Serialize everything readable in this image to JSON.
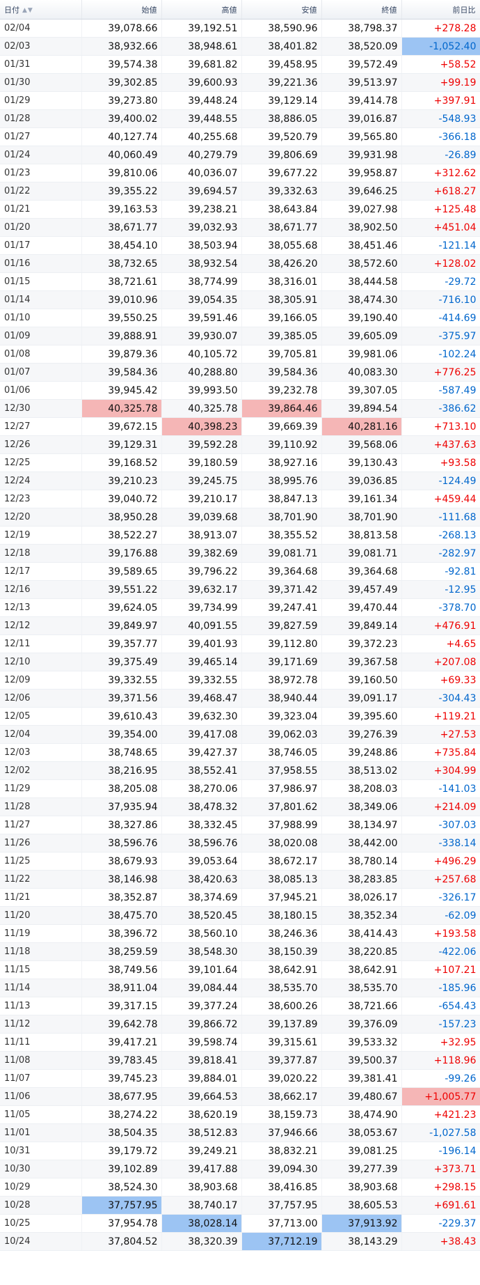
{
  "headers": {
    "date": "日付",
    "sort_icon": "▲▼",
    "open": "始値",
    "high": "高値",
    "low": "安値",
    "close": "終値",
    "change": "前日比"
  },
  "colors": {
    "positive": "#ee0000",
    "negative": "#0066cc",
    "highlight_red": "#f5b6b6",
    "highlight_blue": "#9cc4f3"
  },
  "rows": [
    {
      "date": "02/04",
      "open": "39,078.66",
      "high": "39,192.51",
      "low": "38,590.96",
      "close": "38,798.37",
      "change": "+278.28",
      "dir": "pos"
    },
    {
      "date": "02/03",
      "open": "38,932.66",
      "high": "38,948.61",
      "low": "38,401.82",
      "close": "38,520.09",
      "change": "-1,052.40",
      "dir": "neg",
      "hl": {
        "change": "blue"
      }
    },
    {
      "date": "01/31",
      "open": "39,574.38",
      "high": "39,681.82",
      "low": "39,458.95",
      "close": "39,572.49",
      "change": "+58.52",
      "dir": "pos"
    },
    {
      "date": "01/30",
      "open": "39,302.85",
      "high": "39,600.93",
      "low": "39,221.36",
      "close": "39,513.97",
      "change": "+99.19",
      "dir": "pos"
    },
    {
      "date": "01/29",
      "open": "39,273.80",
      "high": "39,448.24",
      "low": "39,129.14",
      "close": "39,414.78",
      "change": "+397.91",
      "dir": "pos"
    },
    {
      "date": "01/28",
      "open": "39,400.02",
      "high": "39,448.55",
      "low": "38,886.05",
      "close": "39,016.87",
      "change": "-548.93",
      "dir": "neg"
    },
    {
      "date": "01/27",
      "open": "40,127.74",
      "high": "40,255.68",
      "low": "39,520.79",
      "close": "39,565.80",
      "change": "-366.18",
      "dir": "neg"
    },
    {
      "date": "01/24",
      "open": "40,060.49",
      "high": "40,279.79",
      "low": "39,806.69",
      "close": "39,931.98",
      "change": "-26.89",
      "dir": "neg"
    },
    {
      "date": "01/23",
      "open": "39,810.06",
      "high": "40,036.07",
      "low": "39,677.22",
      "close": "39,958.87",
      "change": "+312.62",
      "dir": "pos"
    },
    {
      "date": "01/22",
      "open": "39,355.22",
      "high": "39,694.57",
      "low": "39,332.63",
      "close": "39,646.25",
      "change": "+618.27",
      "dir": "pos"
    },
    {
      "date": "01/21",
      "open": "39,163.53",
      "high": "39,238.21",
      "low": "38,643.84",
      "close": "39,027.98",
      "change": "+125.48",
      "dir": "pos"
    },
    {
      "date": "01/20",
      "open": "38,671.77",
      "high": "39,032.93",
      "low": "38,671.77",
      "close": "38,902.50",
      "change": "+451.04",
      "dir": "pos"
    },
    {
      "date": "01/17",
      "open": "38,454.10",
      "high": "38,503.94",
      "low": "38,055.68",
      "close": "38,451.46",
      "change": "-121.14",
      "dir": "neg"
    },
    {
      "date": "01/16",
      "open": "38,732.65",
      "high": "38,932.54",
      "low": "38,426.20",
      "close": "38,572.60",
      "change": "+128.02",
      "dir": "pos"
    },
    {
      "date": "01/15",
      "open": "38,721.61",
      "high": "38,774.99",
      "low": "38,316.01",
      "close": "38,444.58",
      "change": "-29.72",
      "dir": "neg"
    },
    {
      "date": "01/14",
      "open": "39,010.96",
      "high": "39,054.35",
      "low": "38,305.91",
      "close": "38,474.30",
      "change": "-716.10",
      "dir": "neg"
    },
    {
      "date": "01/10",
      "open": "39,550.25",
      "high": "39,591.46",
      "low": "39,166.05",
      "close": "39,190.40",
      "change": "-414.69",
      "dir": "neg"
    },
    {
      "date": "01/09",
      "open": "39,888.91",
      "high": "39,930.07",
      "low": "39,385.05",
      "close": "39,605.09",
      "change": "-375.97",
      "dir": "neg"
    },
    {
      "date": "01/08",
      "open": "39,879.36",
      "high": "40,105.72",
      "low": "39,705.81",
      "close": "39,981.06",
      "change": "-102.24",
      "dir": "neg"
    },
    {
      "date": "01/07",
      "open": "39,584.36",
      "high": "40,288.80",
      "low": "39,584.36",
      "close": "40,083.30",
      "change": "+776.25",
      "dir": "pos"
    },
    {
      "date": "01/06",
      "open": "39,945.42",
      "high": "39,993.50",
      "low": "39,232.78",
      "close": "39,307.05",
      "change": "-587.49",
      "dir": "neg"
    },
    {
      "date": "12/30",
      "open": "40,325.78",
      "high": "40,325.78",
      "low": "39,864.46",
      "close": "39,894.54",
      "change": "-386.62",
      "dir": "neg",
      "hl": {
        "open": "red",
        "low": "red"
      }
    },
    {
      "date": "12/27",
      "open": "39,672.15",
      "high": "40,398.23",
      "low": "39,669.39",
      "close": "40,281.16",
      "change": "+713.10",
      "dir": "pos",
      "hl": {
        "high": "red",
        "close": "red"
      }
    },
    {
      "date": "12/26",
      "open": "39,129.31",
      "high": "39,592.28",
      "low": "39,110.92",
      "close": "39,568.06",
      "change": "+437.63",
      "dir": "pos"
    },
    {
      "date": "12/25",
      "open": "39,168.52",
      "high": "39,180.59",
      "low": "38,927.16",
      "close": "39,130.43",
      "change": "+93.58",
      "dir": "pos"
    },
    {
      "date": "12/24",
      "open": "39,210.23",
      "high": "39,245.75",
      "low": "38,995.76",
      "close": "39,036.85",
      "change": "-124.49",
      "dir": "neg"
    },
    {
      "date": "12/23",
      "open": "39,040.72",
      "high": "39,210.17",
      "low": "38,847.13",
      "close": "39,161.34",
      "change": "+459.44",
      "dir": "pos"
    },
    {
      "date": "12/20",
      "open": "38,950.28",
      "high": "39,039.68",
      "low": "38,701.90",
      "close": "38,701.90",
      "change": "-111.68",
      "dir": "neg"
    },
    {
      "date": "12/19",
      "open": "38,522.27",
      "high": "38,913.07",
      "low": "38,355.52",
      "close": "38,813.58",
      "change": "-268.13",
      "dir": "neg"
    },
    {
      "date": "12/18",
      "open": "39,176.88",
      "high": "39,382.69",
      "low": "39,081.71",
      "close": "39,081.71",
      "change": "-282.97",
      "dir": "neg"
    },
    {
      "date": "12/17",
      "open": "39,589.65",
      "high": "39,796.22",
      "low": "39,364.68",
      "close": "39,364.68",
      "change": "-92.81",
      "dir": "neg"
    },
    {
      "date": "12/16",
      "open": "39,551.22",
      "high": "39,632.17",
      "low": "39,371.42",
      "close": "39,457.49",
      "change": "-12.95",
      "dir": "neg"
    },
    {
      "date": "12/13",
      "open": "39,624.05",
      "high": "39,734.99",
      "low": "39,247.41",
      "close": "39,470.44",
      "change": "-378.70",
      "dir": "neg"
    },
    {
      "date": "12/12",
      "open": "39,849.97",
      "high": "40,091.55",
      "low": "39,827.59",
      "close": "39,849.14",
      "change": "+476.91",
      "dir": "pos"
    },
    {
      "date": "12/11",
      "open": "39,357.77",
      "high": "39,401.93",
      "low": "39,112.80",
      "close": "39,372.23",
      "change": "+4.65",
      "dir": "pos"
    },
    {
      "date": "12/10",
      "open": "39,375.49",
      "high": "39,465.14",
      "low": "39,171.69",
      "close": "39,367.58",
      "change": "+207.08",
      "dir": "pos"
    },
    {
      "date": "12/09",
      "open": "39,332.55",
      "high": "39,332.55",
      "low": "38,972.78",
      "close": "39,160.50",
      "change": "+69.33",
      "dir": "pos"
    },
    {
      "date": "12/06",
      "open": "39,371.56",
      "high": "39,468.47",
      "low": "38,940.44",
      "close": "39,091.17",
      "change": "-304.43",
      "dir": "neg"
    },
    {
      "date": "12/05",
      "open": "39,610.43",
      "high": "39,632.30",
      "low": "39,323.04",
      "close": "39,395.60",
      "change": "+119.21",
      "dir": "pos"
    },
    {
      "date": "12/04",
      "open": "39,354.00",
      "high": "39,417.08",
      "low": "39,062.03",
      "close": "39,276.39",
      "change": "+27.53",
      "dir": "pos"
    },
    {
      "date": "12/03",
      "open": "38,748.65",
      "high": "39,427.37",
      "low": "38,746.05",
      "close": "39,248.86",
      "change": "+735.84",
      "dir": "pos"
    },
    {
      "date": "12/02",
      "open": "38,216.95",
      "high": "38,552.41",
      "low": "37,958.55",
      "close": "38,513.02",
      "change": "+304.99",
      "dir": "pos"
    },
    {
      "date": "11/29",
      "open": "38,205.08",
      "high": "38,270.06",
      "low": "37,986.97",
      "close": "38,208.03",
      "change": "-141.03",
      "dir": "neg"
    },
    {
      "date": "11/28",
      "open": "37,935.94",
      "high": "38,478.32",
      "low": "37,801.62",
      "close": "38,349.06",
      "change": "+214.09",
      "dir": "pos"
    },
    {
      "date": "11/27",
      "open": "38,327.86",
      "high": "38,332.45",
      "low": "37,988.99",
      "close": "38,134.97",
      "change": "-307.03",
      "dir": "neg"
    },
    {
      "date": "11/26",
      "open": "38,596.76",
      "high": "38,596.76",
      "low": "38,020.08",
      "close": "38,442.00",
      "change": "-338.14",
      "dir": "neg"
    },
    {
      "date": "11/25",
      "open": "38,679.93",
      "high": "39,053.64",
      "low": "38,672.17",
      "close": "38,780.14",
      "change": "+496.29",
      "dir": "pos"
    },
    {
      "date": "11/22",
      "open": "38,146.98",
      "high": "38,420.63",
      "low": "38,085.13",
      "close": "38,283.85",
      "change": "+257.68",
      "dir": "pos"
    },
    {
      "date": "11/21",
      "open": "38,352.87",
      "high": "38,374.69",
      "low": "37,945.21",
      "close": "38,026.17",
      "change": "-326.17",
      "dir": "neg"
    },
    {
      "date": "11/20",
      "open": "38,475.70",
      "high": "38,520.45",
      "low": "38,180.15",
      "close": "38,352.34",
      "change": "-62.09",
      "dir": "neg"
    },
    {
      "date": "11/19",
      "open": "38,396.72",
      "high": "38,560.10",
      "low": "38,246.36",
      "close": "38,414.43",
      "change": "+193.58",
      "dir": "pos"
    },
    {
      "date": "11/18",
      "open": "38,259.59",
      "high": "38,548.30",
      "low": "38,150.39",
      "close": "38,220.85",
      "change": "-422.06",
      "dir": "neg"
    },
    {
      "date": "11/15",
      "open": "38,749.56",
      "high": "39,101.64",
      "low": "38,642.91",
      "close": "38,642.91",
      "change": "+107.21",
      "dir": "pos"
    },
    {
      "date": "11/14",
      "open": "38,911.04",
      "high": "39,084.44",
      "low": "38,535.70",
      "close": "38,535.70",
      "change": "-185.96",
      "dir": "neg"
    },
    {
      "date": "11/13",
      "open": "39,317.15",
      "high": "39,377.24",
      "low": "38,600.26",
      "close": "38,721.66",
      "change": "-654.43",
      "dir": "neg"
    },
    {
      "date": "11/12",
      "open": "39,642.78",
      "high": "39,866.72",
      "low": "39,137.89",
      "close": "39,376.09",
      "change": "-157.23",
      "dir": "neg"
    },
    {
      "date": "11/11",
      "open": "39,417.21",
      "high": "39,598.74",
      "low": "39,315.61",
      "close": "39,533.32",
      "change": "+32.95",
      "dir": "pos"
    },
    {
      "date": "11/08",
      "open": "39,783.45",
      "high": "39,818.41",
      "low": "39,377.87",
      "close": "39,500.37",
      "change": "+118.96",
      "dir": "pos"
    },
    {
      "date": "11/07",
      "open": "39,745.23",
      "high": "39,884.01",
      "low": "39,020.22",
      "close": "39,381.41",
      "change": "-99.26",
      "dir": "neg"
    },
    {
      "date": "11/06",
      "open": "38,677.95",
      "high": "39,664.53",
      "low": "38,662.17",
      "close": "39,480.67",
      "change": "+1,005.77",
      "dir": "pos",
      "hl": {
        "change": "red"
      }
    },
    {
      "date": "11/05",
      "open": "38,274.22",
      "high": "38,620.19",
      "low": "38,159.73",
      "close": "38,474.90",
      "change": "+421.23",
      "dir": "pos"
    },
    {
      "date": "11/01",
      "open": "38,504.35",
      "high": "38,512.83",
      "low": "37,946.66",
      "close": "38,053.67",
      "change": "-1,027.58",
      "dir": "neg"
    },
    {
      "date": "10/31",
      "open": "39,179.72",
      "high": "39,249.21",
      "low": "38,832.21",
      "close": "39,081.25",
      "change": "-196.14",
      "dir": "neg"
    },
    {
      "date": "10/30",
      "open": "39,102.89",
      "high": "39,417.88",
      "low": "39,094.30",
      "close": "39,277.39",
      "change": "+373.71",
      "dir": "pos"
    },
    {
      "date": "10/29",
      "open": "38,524.30",
      "high": "38,903.68",
      "low": "38,416.85",
      "close": "38,903.68",
      "change": "+298.15",
      "dir": "pos"
    },
    {
      "date": "10/28",
      "open": "37,757.95",
      "high": "38,740.17",
      "low": "37,757.95",
      "close": "38,605.53",
      "change": "+691.61",
      "dir": "pos",
      "hl": {
        "open": "blue"
      }
    },
    {
      "date": "10/25",
      "open": "37,954.78",
      "high": "38,028.14",
      "low": "37,713.00",
      "close": "37,913.92",
      "change": "-229.37",
      "dir": "neg",
      "hl": {
        "high": "blue",
        "close": "blue"
      }
    },
    {
      "date": "10/24",
      "open": "37,804.52",
      "high": "38,320.39",
      "low": "37,712.19",
      "close": "38,143.29",
      "change": "+38.43",
      "dir": "pos",
      "hl": {
        "low": "blue"
      }
    }
  ]
}
